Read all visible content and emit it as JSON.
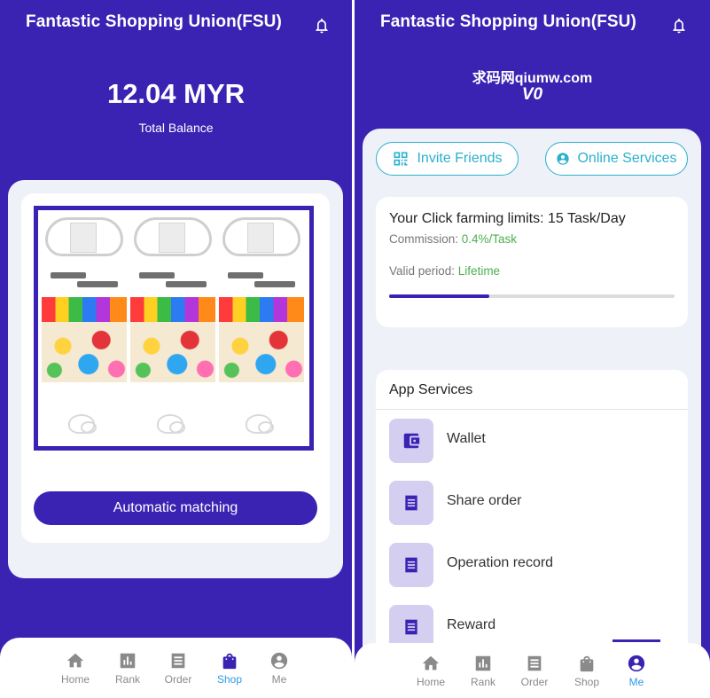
{
  "left": {
    "header": {
      "title": "Fantastic Shopping Union(FSU)",
      "bell_icon": "bell-icon"
    },
    "balance": {
      "amount": "12.04 MYR",
      "label": "Total Balance"
    },
    "match_button_label": "Automatic matching",
    "tabs": [
      {
        "label": "Home",
        "icon": "home-icon",
        "active": false
      },
      {
        "label": "Rank",
        "icon": "rank-icon",
        "active": false
      },
      {
        "label": "Order",
        "icon": "order-icon",
        "active": false
      },
      {
        "label": "Shop",
        "icon": "shop-bag-icon",
        "active": true
      },
      {
        "label": "Me",
        "icon": "account-icon",
        "active": false
      }
    ]
  },
  "right": {
    "header": {
      "title": "Fantastic Shopping Union(FSU)",
      "bell_icon": "bell-icon"
    },
    "brand": "求码网qiumw.com",
    "vip": "V0",
    "invite_label": "Invite Friends",
    "online_label": "Online Services",
    "limits": {
      "title": "Your Click farming limits: 15 Task/Day",
      "commission_label": "Commission: ",
      "commission_value": "0.4%/Task",
      "valid_label": "Valid period: ",
      "valid_value": "Lifetime",
      "progress_fraction": 0.35
    },
    "services": {
      "title": "App Services",
      "items": [
        {
          "label": "Wallet",
          "icon": "wallet-icon"
        },
        {
          "label": "Share order",
          "icon": "receipt-icon"
        },
        {
          "label": "Operation record",
          "icon": "receipt-icon"
        },
        {
          "label": "Reward",
          "icon": "receipt-icon"
        }
      ]
    },
    "tabs": [
      {
        "label": "Home",
        "icon": "home-icon",
        "active": false
      },
      {
        "label": "Rank",
        "icon": "rank-icon",
        "active": false
      },
      {
        "label": "Order",
        "icon": "order-icon",
        "active": false
      },
      {
        "label": "Shop",
        "icon": "shop-bag-icon",
        "active": false
      },
      {
        "label": "Me",
        "icon": "account-icon",
        "active": true
      }
    ]
  },
  "colors": {
    "primary": "#3a23b3",
    "accent_cyan": "#2bb0ce",
    "active_tab": "#2f9be8",
    "green": "#4caf50",
    "panel_bg": "#eef1f8",
    "service_icon_bg": "#d4cff1"
  }
}
